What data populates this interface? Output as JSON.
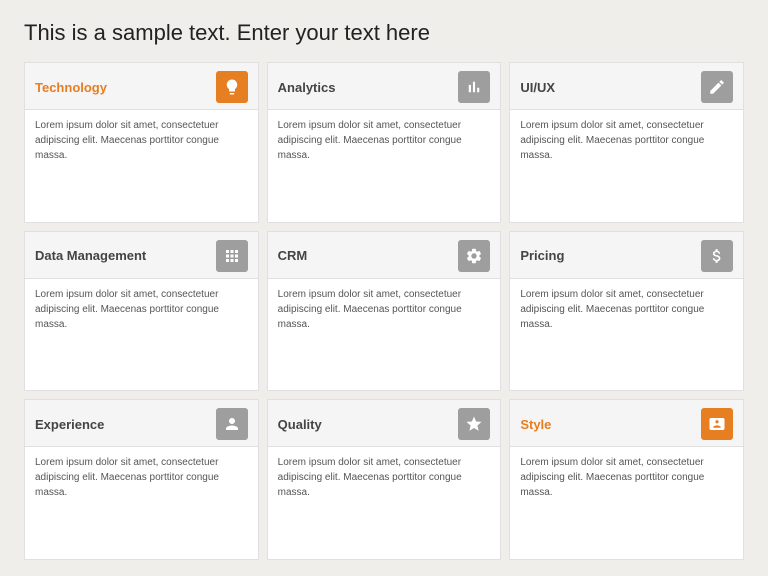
{
  "page": {
    "title": "This is a sample text. Enter your text here"
  },
  "cards": [
    {
      "id": "technology",
      "title": "Technology",
      "titleColor": "orange",
      "iconColor": "orange",
      "icon": "💡",
      "iconSymbol": "bulb",
      "body": "Lorem ipsum dolor sit amet, consectetuer adipiscing elit. Maecenas porttitor congue massa."
    },
    {
      "id": "analytics",
      "title": "Analytics",
      "titleColor": "normal",
      "iconColor": "gray",
      "icon": "📊",
      "iconSymbol": "bar-chart",
      "body": "Lorem ipsum dolor sit amet, consectetuer adipiscing elit. Maecenas porttitor congue massa."
    },
    {
      "id": "uiux",
      "title": "UI/UX",
      "titleColor": "normal",
      "iconColor": "gray",
      "icon": "✏",
      "iconSymbol": "pen",
      "body": "Lorem ipsum dolor sit amet, consectetuer adipiscing elit. Maecenas porttitor congue massa."
    },
    {
      "id": "data-management",
      "title": "Data Management",
      "titleColor": "normal",
      "iconColor": "gray",
      "icon": "⊞",
      "iconSymbol": "grid",
      "body": "Lorem ipsum dolor sit amet, consectetuer adipiscing elit. Maecenas porttitor congue massa."
    },
    {
      "id": "crm",
      "title": "CRM",
      "titleColor": "normal",
      "iconColor": "gray",
      "icon": "⚙",
      "iconSymbol": "gear",
      "body": "Lorem ipsum dolor sit amet, consectetuer adipiscing elit. Maecenas porttitor congue massa."
    },
    {
      "id": "pricing",
      "title": "Pricing",
      "titleColor": "normal",
      "iconColor": "gray",
      "icon": "💰",
      "iconSymbol": "coins",
      "body": "Lorem ipsum dolor sit amet, consectetuer adipiscing elit. Maecenas porttitor congue massa."
    },
    {
      "id": "experience",
      "title": "Experience",
      "titleColor": "normal",
      "iconColor": "gray",
      "icon": "👤",
      "iconSymbol": "person",
      "body": "Lorem ipsum dolor sit amet, consectetuer adipiscing elit. Maecenas porttitor congue massa."
    },
    {
      "id": "quality",
      "title": "Quality",
      "titleColor": "normal",
      "iconColor": "gray",
      "icon": "★",
      "iconSymbol": "star",
      "body": "Lorem ipsum dolor sit amet, consectetuer adipiscing elit. Maecenas porttitor congue massa."
    },
    {
      "id": "style",
      "title": "Style",
      "titleColor": "orange",
      "iconColor": "orange",
      "icon": "🪪",
      "iconSymbol": "id-card",
      "body": "Lorem ipsum dolor sit amet, consectetuer adipiscing elit. Maecenas porttitor congue massa."
    }
  ]
}
